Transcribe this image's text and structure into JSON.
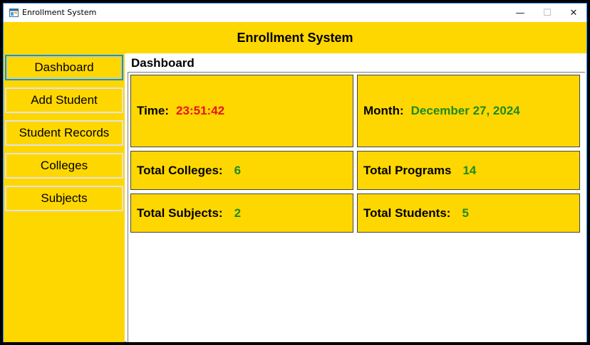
{
  "window": {
    "title": "Enrollment System",
    "controls": {
      "minimize": "—",
      "maximize": "☐",
      "close": "✕"
    }
  },
  "header": {
    "title": "Enrollment System"
  },
  "sidebar": {
    "items": [
      {
        "label": "Dashboard",
        "active": true
      },
      {
        "label": "Add Student",
        "active": false
      },
      {
        "label": "Student Records",
        "active": false
      },
      {
        "label": "Colleges",
        "active": false
      },
      {
        "label": "Subjects",
        "active": false
      }
    ]
  },
  "main": {
    "title": "Dashboard",
    "cards": {
      "time": {
        "label": "Time:",
        "value": "23:51:42"
      },
      "month": {
        "label": "Month:",
        "value": "December 27, 2024"
      },
      "colleges": {
        "label": "Total Colleges:",
        "value": "6"
      },
      "programs": {
        "label": "Total Programs",
        "value": "14"
      },
      "subjects": {
        "label": "Total Subjects:",
        "value": "2"
      },
      "students": {
        "label": "Total Students:",
        "value": "5"
      }
    }
  },
  "colors": {
    "accent": "#ffd700",
    "value_red": "#e8141a",
    "value_green": "#1f8a1f",
    "active_border": "#1e8fd0"
  }
}
